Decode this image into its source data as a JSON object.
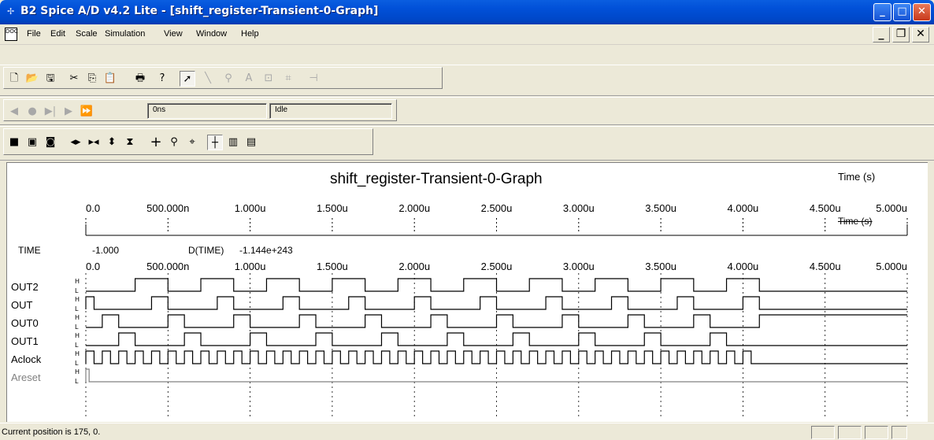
{
  "window": {
    "title": "B2 Spice A/D v4.2 Lite - [shift_register-Transient-0-Graph]"
  },
  "menu": {
    "items": [
      "File",
      "Edit",
      "Scale",
      "Simulation",
      "View",
      "Window",
      "Help"
    ]
  },
  "toolbar1": {
    "icons": [
      "new-file-icon",
      "open-folder-icon",
      "save-icon",
      "cut-icon",
      "copy-icon",
      "paste-icon",
      "print-icon",
      "help-icon",
      "select-arrow-icon",
      "wire-icon",
      "probe-icon",
      "text-icon",
      "component-icon",
      "crosshair-icon",
      "pin-icon"
    ]
  },
  "toolbar2": {
    "icons": [
      "step-back-icon",
      "record-icon",
      "step-forward-icon",
      "play-icon",
      "fast-forward-icon"
    ],
    "time_value": "0ns",
    "status_value": "Idle"
  },
  "toolbar3": {
    "icons": [
      "fit-all-icon",
      "fit-vertical-icon",
      "fit-horizontal-icon",
      "expand-horizontal-icon",
      "shrink-horizontal-icon",
      "expand-vertical-icon",
      "shrink-vertical-icon",
      "cursor-cross-icon",
      "zoom-icon",
      "measure-icon",
      "cursor-line-icon",
      "columns-icon",
      "rows-icon"
    ]
  },
  "graph": {
    "title": "shift_register-Transient-0-Graph",
    "time_unit": "Time  (s)",
    "axis_overlay_label": "Time  (s)",
    "cursor_readout": {
      "label": "TIME",
      "value": "-1.000",
      "dlabel": "D(TIME)",
      "dvalue": "-1.144e+243"
    }
  },
  "chart_data": {
    "type": "line",
    "title": "shift_register-Transient-0-Graph",
    "xlabel": "Time  (s)",
    "xlim": [
      0,
      5e-06
    ],
    "x_ticks": [
      "0.0",
      "500.000n",
      "1.000u",
      "1.500u",
      "2.000u",
      "2.500u",
      "3.000u",
      "3.500u",
      "4.000u",
      "4.500u",
      "5.000u"
    ],
    "digital_levels": [
      "H",
      "L"
    ],
    "series": [
      {
        "name": "OUT2",
        "color": "#000000",
        "transitions_us": [
          0.3,
          0.5,
          0.7,
          0.9,
          1.1,
          1.3,
          1.5,
          1.7,
          1.9,
          2.1,
          2.3,
          2.5,
          2.7,
          2.9,
          3.1,
          3.3,
          3.5,
          3.7,
          3.9,
          4.1
        ]
      },
      {
        "name": "OUT",
        "color": "#000000",
        "transitions_us": [
          0.0,
          0.05,
          0.4,
          0.5,
          0.8,
          0.9,
          1.2,
          1.3,
          1.6,
          1.7,
          2.0,
          2.1,
          2.4,
          2.5,
          2.8,
          2.9,
          3.2,
          3.3,
          3.6,
          3.7,
          4.0,
          4.1
        ]
      },
      {
        "name": "OUT0",
        "color": "#000000",
        "transitions_us": [
          0.1,
          0.2,
          0.5,
          0.6,
          0.9,
          1.0,
          1.3,
          1.4,
          1.7,
          1.8,
          2.1,
          2.2,
          2.5,
          2.6,
          2.9,
          3.0,
          3.3,
          3.4,
          3.7,
          3.8,
          4.1
        ]
      },
      {
        "name": "OUT1",
        "color": "#000000",
        "transitions_us": [
          0.2,
          0.3,
          0.6,
          0.7,
          1.0,
          1.1,
          1.4,
          1.5,
          1.8,
          1.9,
          2.2,
          2.3,
          2.6,
          2.7,
          3.0,
          3.1,
          3.4,
          3.5,
          3.8,
          3.9
        ]
      },
      {
        "name": "Aclock",
        "color": "#000000",
        "period_us": 0.1,
        "duty": 0.5,
        "end_us": 4.1
      },
      {
        "name": "Areset",
        "color": "#808080",
        "transitions_us": [
          0.0,
          0.02
        ]
      }
    ]
  },
  "status": {
    "text": "Current position is 175, 0."
  }
}
